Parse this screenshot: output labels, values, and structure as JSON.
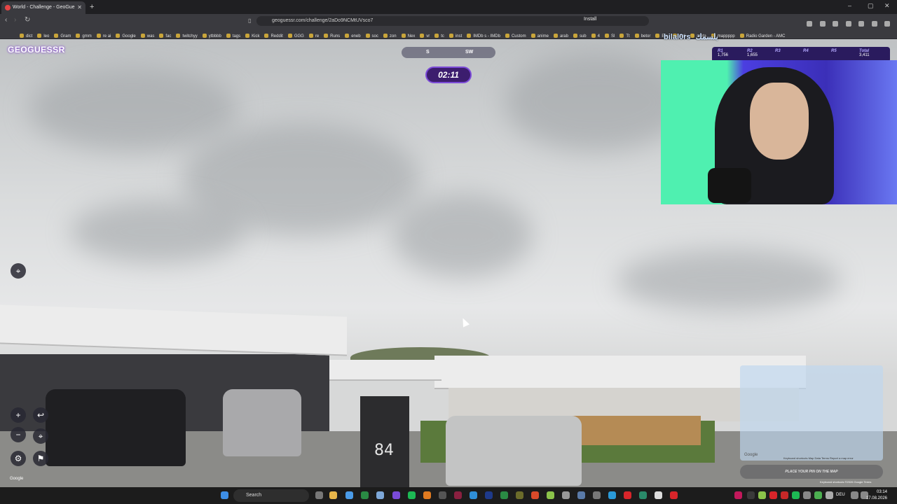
{
  "browser": {
    "tab_title": "World - Challenge - GeoGue",
    "url": "geoguessr.com/challenge/2aDo9NCMtUVsco7",
    "install_label": "Install",
    "bookmarks": [
      "dict",
      "leo",
      "Gram",
      "gmm",
      "re ai",
      "Google",
      "was",
      "fac",
      "twitchyy",
      "ytbbbb",
      "tags",
      "Kick",
      "Reddit",
      "GGG",
      "re",
      "Runs",
      "eneb",
      "soc",
      "zon",
      "Nex",
      "vr",
      "tc",
      "inst",
      "IMDb s - IMDb",
      "Custom",
      "anime",
      "arab",
      "sub",
      "4",
      "Sl",
      "Tt",
      "betor",
      "Ele",
      "acti",
      "meta",
      "mappppp",
      "Radio Garden - AMC"
    ]
  },
  "game": {
    "logo": "GEOGUESSR",
    "compass": {
      "s": "S",
      "sw": "SW"
    },
    "timer": "02:11",
    "house_number": "84",
    "guess_hint": "PLACE YOUR PIN ON THE MAP",
    "google_attribution": "Google",
    "map_footer": "Keyboard shortcuts  Map Data  Terms  Report a map error",
    "sv_attribution": "Keyboard shortcuts  ©2026 Google  Terms",
    "map_google": "Google"
  },
  "stream": {
    "streamer_name": "bilal0rs",
    "arabic_name": "بلسمك",
    "scores": [
      {
        "label": "R1",
        "value": "1,756"
      },
      {
        "label": "R2",
        "value": "1,655"
      },
      {
        "label": "R3",
        "value": ""
      },
      {
        "label": "R4",
        "value": ""
      },
      {
        "label": "R5",
        "value": ""
      },
      {
        "label": "Total",
        "value": "3,411"
      }
    ]
  },
  "taskbar": {
    "search_label": "Search",
    "lang": "DEU",
    "time": "03:14",
    "date": "17.08.2026"
  }
}
